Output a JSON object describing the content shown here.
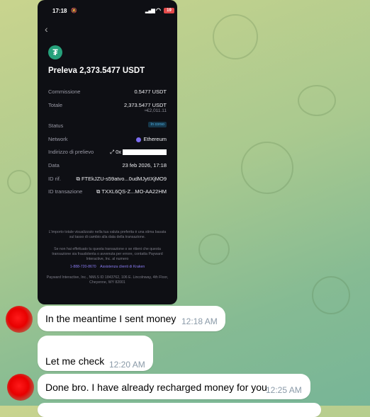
{
  "phone": {
    "status_time": "17:18",
    "battery": "19",
    "title": "Preleva 2,373.5477 USDT",
    "token_symbol": "₮",
    "rows": {
      "fee_label": "Commissione",
      "fee_value": "0.5477 USDT",
      "total_label": "Totale",
      "total_value": "2,373.5477 USDT",
      "total_fiat": "≈€2,011.11",
      "status_label": "Status",
      "status_value": "In corso",
      "network_label": "Network",
      "network_value": "Ethereum",
      "address_label": "Indirizzo di prelievo",
      "address_prefix": "0x",
      "date_label": "Data",
      "date_value": "23 feb 2026, 17:18",
      "ref_label": "ID rif.",
      "ref_value": "FTEkJZU-s59atvo...0udMJytIXjMO9",
      "txid_label": "ID transazione",
      "txid_value": "TXXL6QS-Z...MO-AA22HM"
    },
    "footer": {
      "p1": "L'importo totale visualizzato nella tua valuta preferita è una stima basata sul tasso di cambio alla data della transazione.",
      "p2": "Se non hai effettuato tu questa transazione o se ritieni che questa transazione sia fraudolenta o avvenuta per errore, contatta Payward Interactive, Inc. al numero",
      "phone_link": "1-888-720-8670",
      "support_link": "Assistenza clienti di Kraken",
      "p3": "Payward Interactive, Inc., NMLS ID 1843762, 106 E. Lincolnway, 4th Floor, Cheyenne, WY 82001"
    }
  },
  "messages": [
    {
      "text": "In the meantime I sent money",
      "time": "12:18 AM"
    },
    {
      "text": "Let me check",
      "time": "12:20 AM"
    },
    {
      "text": "Done bro. I have already recharged money for you",
      "time": "12:25 AM"
    }
  ],
  "colors": {
    "usdt": "#26a17b",
    "ethereum": "#7b6cf0",
    "avatar": "#e80000"
  }
}
